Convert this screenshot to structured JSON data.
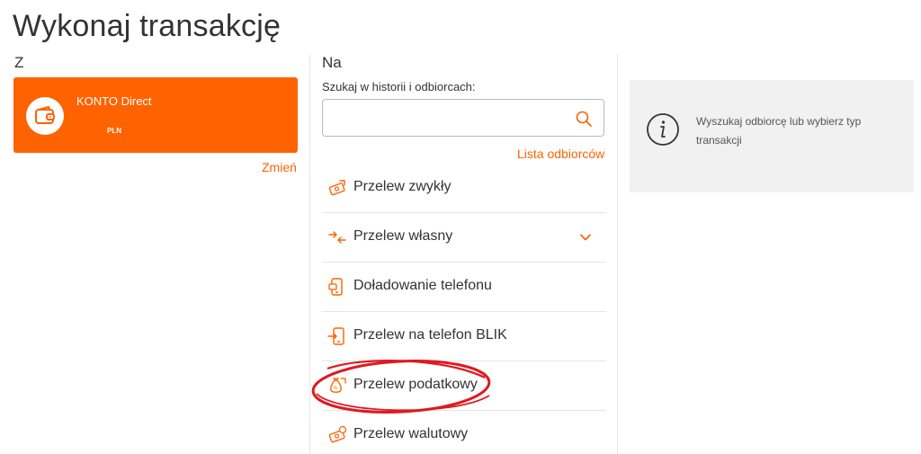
{
  "page": {
    "title": "Wykonaj transakcję"
  },
  "from": {
    "label": "Z",
    "account": {
      "name": "KONTO Direct",
      "currency": "PLN",
      "icon": "wallet-icon"
    },
    "change_link": "Zmień"
  },
  "to": {
    "label": "Na",
    "search": {
      "label": "Szukaj w historii i odbiorcach:",
      "value": "",
      "placeholder": ""
    },
    "recipients_link": "Lista odbiorców",
    "transactions": [
      {
        "label": "Przelew zwykły",
        "icon": "money-transfer-icon"
      },
      {
        "label": "Przelew własny",
        "icon": "own-transfer-arrows-icon"
      },
      {
        "label": "Doładowanie telefonu",
        "icon": "phone-topup-icon"
      },
      {
        "label": "Przelew na telefon BLIK",
        "icon": "phone-blik-icon"
      },
      {
        "label": "Przelew podatkowy",
        "icon": "tax-bag-icon"
      },
      {
        "label": "Przelew walutowy",
        "icon": "currency-transfer-icon"
      }
    ]
  },
  "info": {
    "text": "Wyszukaj odbiorcę lub wybierz typ transakcji",
    "icon": "info-icon"
  },
  "colors": {
    "accent": "#ff6200",
    "highlight_circle": "#e0191f",
    "info_bg": "#f1f1f1"
  }
}
